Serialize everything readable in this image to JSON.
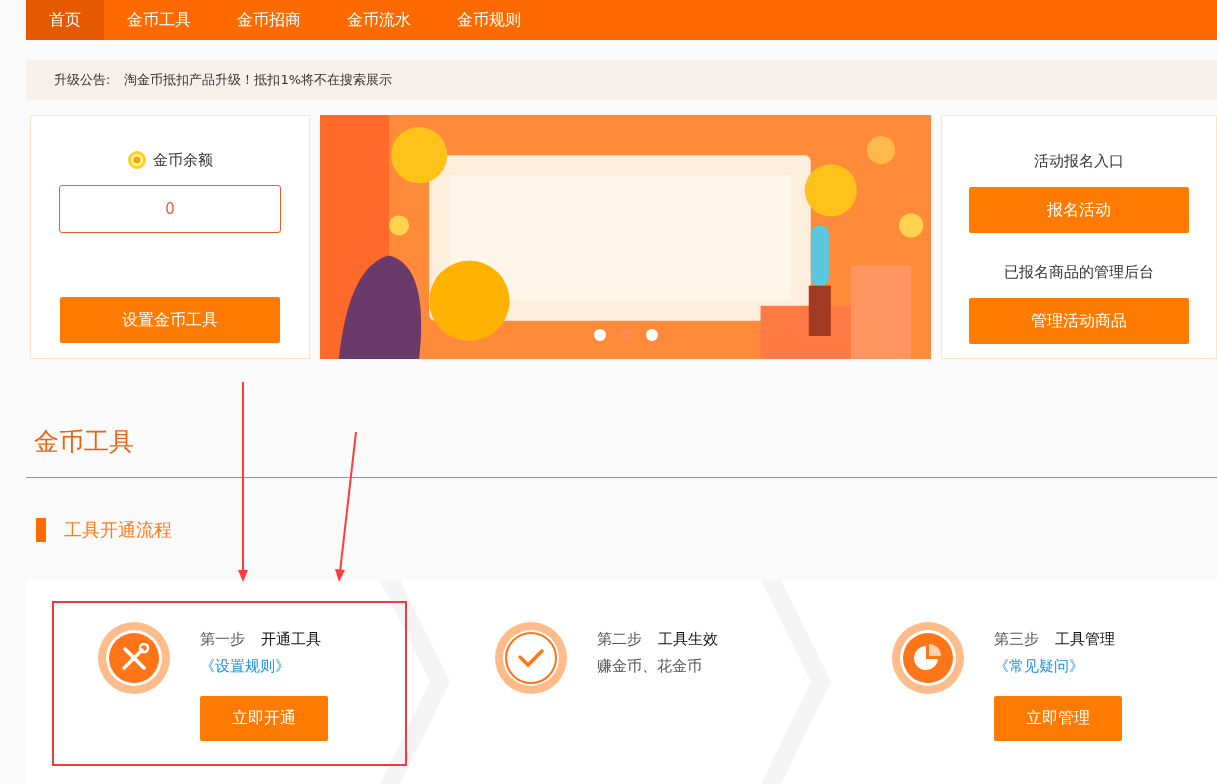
{
  "nav": [
    {
      "label": "首页",
      "selected": true
    },
    {
      "label": "金币工具",
      "selected": false
    },
    {
      "label": "金币招商",
      "selected": false
    },
    {
      "label": "金币流水",
      "selected": false
    },
    {
      "label": "金币规则",
      "selected": false
    }
  ],
  "notice": {
    "label": "升级公告:",
    "text": "淘金币抵扣产品升级！抵扣1%将不在搜索展示"
  },
  "balance": {
    "label": "金币余额",
    "value": "0",
    "button": "设置金币工具"
  },
  "banner": {
    "dots": [
      {
        "selected": false
      },
      {
        "selected": true
      },
      {
        "selected": false
      }
    ]
  },
  "activity": {
    "label": "活动报名入口",
    "button": "报名活动",
    "label_2": "已报名商品的管理后台",
    "button_2": "管理活动商品"
  },
  "section": {
    "title": "金币工具",
    "subtitle": "工具开通流程"
  },
  "steps": [
    {
      "kind": "tools",
      "step": "第一步",
      "title": "开通工具",
      "link": "《设置规则》",
      "button": "立即开通",
      "highlighted": true
    },
    {
      "kind": "check",
      "step": "第二步",
      "title": "工具生效",
      "note": "赚金币、花金币",
      "highlighted": false
    },
    {
      "kind": "pie",
      "step": "第三步",
      "title": "工具管理",
      "link": "《常见疑问》",
      "button": "立即管理",
      "highlighted": false
    }
  ]
}
